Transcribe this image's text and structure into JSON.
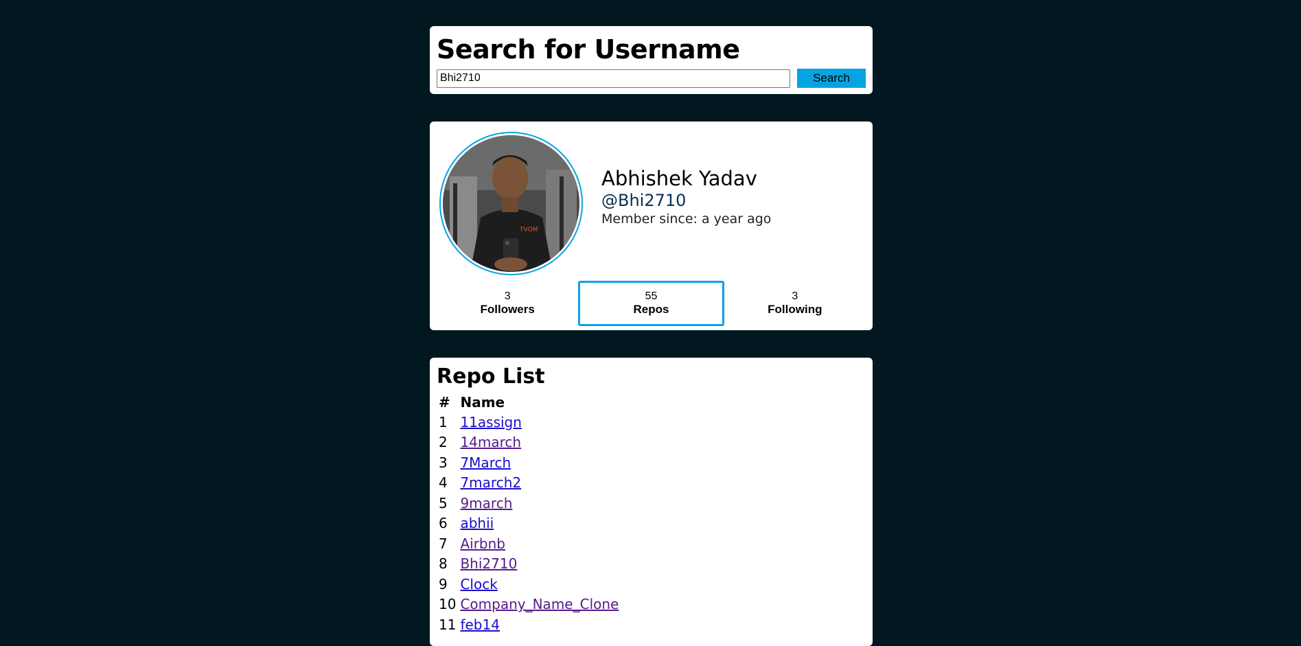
{
  "search": {
    "title": "Search for Username",
    "value": "Bhi2710",
    "button_label": "Search"
  },
  "profile": {
    "name": "Abhishek Yadav",
    "handle": "@Bhi2710",
    "member_since": "Member since: a year ago",
    "stats": [
      {
        "value": "3",
        "label": "Followers"
      },
      {
        "value": "55",
        "label": "Repos"
      },
      {
        "value": "3",
        "label": "Following"
      }
    ],
    "active_stat": "Repos"
  },
  "repos": {
    "title": "Repo List",
    "columns": [
      "#",
      "Name"
    ],
    "rows": [
      {
        "num": "1",
        "name": "11assign",
        "visited": false
      },
      {
        "num": "2",
        "name": "14march",
        "visited": true
      },
      {
        "num": "3",
        "name": "7March",
        "visited": false
      },
      {
        "num": "4",
        "name": "7march2",
        "visited": false
      },
      {
        "num": "5",
        "name": "9march",
        "visited": true
      },
      {
        "num": "6",
        "name": "abhii",
        "visited": false
      },
      {
        "num": "7",
        "name": "Airbnb",
        "visited": true
      },
      {
        "num": "8",
        "name": "Bhi2710",
        "visited": true
      },
      {
        "num": "9",
        "name": "Clock",
        "visited": false
      },
      {
        "num": "10",
        "name": "Company_Name_Clone",
        "visited": true
      },
      {
        "num": "11",
        "name": "feb14",
        "visited": false
      }
    ]
  },
  "colors": {
    "background": "#011821",
    "accent": "#06a3e3",
    "link": "#1a0dcc",
    "visited_link": "#551a8b"
  }
}
